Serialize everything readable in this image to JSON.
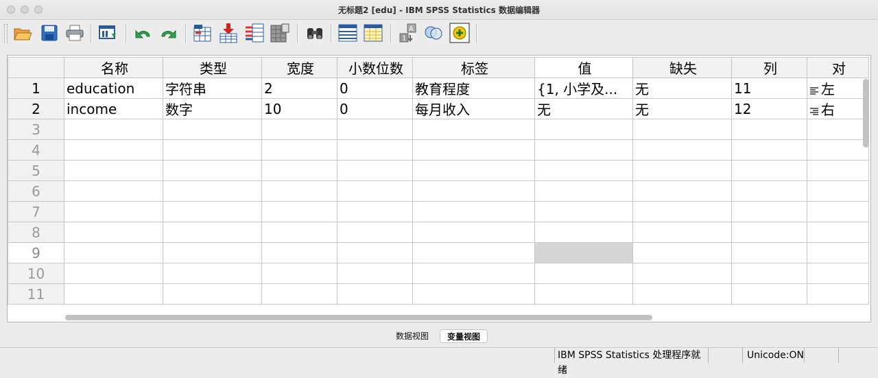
{
  "window": {
    "title": "无标题2 [edu] - IBM SPSS Statistics 数据编辑器"
  },
  "toolbar": {
    "buttons": [
      "open-icon",
      "save-icon",
      "print-icon",
      "recall-dialog-icon",
      "undo-icon",
      "redo-icon",
      "goto-case-icon",
      "goto-variable-icon",
      "variables-icon",
      "insert-cases-icon",
      "find-icon",
      "insert-variable-icon",
      "split-file-icon",
      "weight-cases-icon",
      "select-cases-icon",
      "value-labels-icon",
      "use-sets-icon"
    ]
  },
  "grid": {
    "columns": [
      "名称",
      "类型",
      "宽度",
      "小数位数",
      "标签",
      "值",
      "缺失",
      "列",
      "对"
    ],
    "rows": [
      {
        "num": "1",
        "cells": [
          "education",
          "字符串",
          "2",
          "0",
          "教育程度",
          "{1, 小学及...",
          "无",
          "11",
          "左"
        ]
      },
      {
        "num": "2",
        "cells": [
          "income",
          "数字",
          "10",
          "0",
          "每月收入",
          "无",
          "无",
          "12",
          "右"
        ]
      },
      {
        "num": "3",
        "cells": [
          "",
          "",
          "",
          "",
          "",
          "",
          "",
          "",
          ""
        ]
      },
      {
        "num": "4",
        "cells": [
          "",
          "",
          "",
          "",
          "",
          "",
          "",
          "",
          ""
        ]
      },
      {
        "num": "5",
        "cells": [
          "",
          "",
          "",
          "",
          "",
          "",
          "",
          "",
          ""
        ]
      },
      {
        "num": "6",
        "cells": [
          "",
          "",
          "",
          "",
          "",
          "",
          "",
          "",
          ""
        ]
      },
      {
        "num": "7",
        "cells": [
          "",
          "",
          "",
          "",
          "",
          "",
          "",
          "",
          ""
        ]
      },
      {
        "num": "8",
        "cells": [
          "",
          "",
          "",
          "",
          "",
          "",
          "",
          "",
          ""
        ]
      },
      {
        "num": "9",
        "cells": [
          "",
          "",
          "",
          "",
          "",
          "",
          "",
          "",
          ""
        ]
      },
      {
        "num": "10",
        "cells": [
          "",
          "",
          "",
          "",
          "",
          "",
          "",
          "",
          ""
        ]
      },
      {
        "num": "11",
        "cells": [
          "",
          "",
          "",
          "",
          "",
          "",
          "",
          "",
          ""
        ]
      }
    ]
  },
  "tabs": {
    "data_view": "数据视图",
    "variable_view": "变量视图"
  },
  "status": {
    "processor": "IBM SPSS Statistics 处理程序就绪",
    "unicode": "Unicode:ON"
  }
}
